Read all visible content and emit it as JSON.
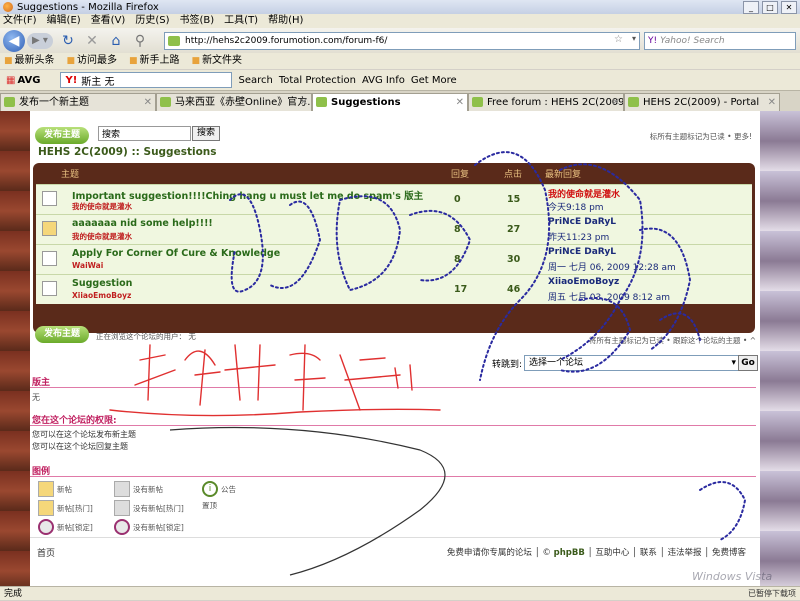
{
  "window": {
    "title": "Suggestions - Mozilla Firefox"
  },
  "menu": [
    "文件(F)",
    "编辑(E)",
    "查看(V)",
    "历史(S)",
    "书签(B)",
    "工具(T)",
    "帮助(H)"
  ],
  "nav": {
    "url": "http://hehs2c2009.forumotion.com/forum-f6/",
    "search_placeholder": "Yahoo! Search"
  },
  "bookmarks": [
    "最新头条",
    "访问最多",
    "新手上路",
    "新文件夹"
  ],
  "avg": {
    "label": "AVG",
    "yahoo_value": "斯主 无",
    "search": "Search",
    "total_protection": "Total Protection",
    "avg_info": "AVG Info",
    "get_more": "Get More"
  },
  "tabs": [
    {
      "label": "发布一个新主题"
    },
    {
      "label": "马来西亚《赤壁Online》官方..."
    },
    {
      "label": "Suggestions"
    },
    {
      "label": "Free forum : HEHS 2C(2009)"
    },
    {
      "label": "HEHS 2C(2009) - Portal"
    }
  ],
  "forum": {
    "new_topic": "发布主题",
    "search_value": "搜索",
    "search_button": "搜索",
    "mark_top": "标所有主题标记为已读 • 更多!",
    "title": "HEHS 2C(2009) :: Suggestions",
    "thead_topics": "主题",
    "thead_replies": "回复",
    "thead_views": "点击",
    "thead_last": "最新回复",
    "topics": [
      {
        "title": "Important suggestion!!!!Ching hang u must let me do spam's 版主",
        "author": "我的使命就是灌水",
        "replies": "0",
        "views": "15",
        "last_author": "我的使命就是灌水",
        "last_time": "今天9:18 pm",
        "hot": false,
        "last_red": true
      },
      {
        "title": "aaaaaaa nid some help!!!!",
        "author": "我的使命就是灌水",
        "replies": "8",
        "views": "27",
        "last_author": "PriNcE DaRyL",
        "last_time": "昨天11:23 pm",
        "hot": true,
        "last_red": false
      },
      {
        "title": "Apply For Corner Of Cure & Knowledge",
        "author": "WaiWai",
        "replies": "8",
        "views": "30",
        "last_author": "PriNcE DaRyL",
        "last_time": "周一 七月 06, 2009 12:28 am",
        "hot": false,
        "last_red": false
      },
      {
        "title": "Suggestion",
        "author": "XiiaoEmoBoyz",
        "replies": "17",
        "views": "46",
        "last_author": "XiiaoEmoBoyz",
        "last_time": "周五 七月 03, 2009 8:12 am",
        "hot": false,
        "last_red": false
      }
    ],
    "new_topic_bottom": "发布主题",
    "users_browsing": "正在浏览这个论坛的用户： 无",
    "mark_bottom": "将所有主题标记为已读 • 跟踪这个论坛的主题 • ^",
    "jump_label": "转跳到:",
    "jump_value": "选择一个论坛",
    "go": "Go",
    "moderator_h": "版主",
    "moderator_v": "无",
    "perm_h": "您在这个论坛的权限:",
    "perm_1": "您可以在这个论坛发布新主题",
    "perm_2": "您可以在这个论坛回复主题",
    "legend_h": "图例",
    "legend": [
      "新帖",
      "没有新帖",
      "新帖[热门]",
      "没有新帖[热门]",
      "新帖[锁定]",
      "没有新帖[锁定]",
      "公告",
      "置顶"
    ],
    "footer_home": "首页",
    "footer_links": "免费申请你专属的论坛",
    "footer_phpbb": "phpBB",
    "footer_help": "互助中心",
    "footer_contact": "联系",
    "footer_report": "违法举报",
    "footer_blog": "免费博客"
  },
  "status": {
    "left": "完成",
    "right": "已暂停下载项"
  },
  "colors": {
    "link_green": "#3b5a1a",
    "accent_red": "#d01010",
    "brown": "#5a2a1a"
  }
}
